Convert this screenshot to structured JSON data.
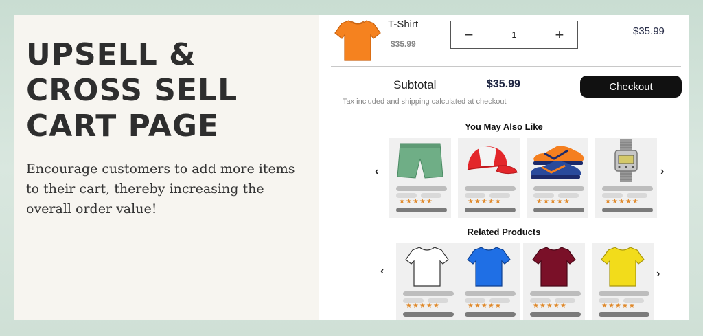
{
  "hero": {
    "title_lines": [
      "UPSELL &",
      "CROSS SELL",
      "CART PAGE"
    ],
    "blurb": "Encourage customers to add more items to their cart, thereby increasing the overall order value!"
  },
  "cart": {
    "item": {
      "name": "T-Shirt",
      "unit_price": "$35.99",
      "quantity": "1",
      "line_price": "$35.99",
      "icon": "orange-tshirt"
    },
    "minus_label": "−",
    "plus_label": "+",
    "subtotal_label": "Subtotal",
    "subtotal_value": "$35.99",
    "checkout_label": "Checkout",
    "tax_note": "Tax included and shipping calculated at checkout"
  },
  "upsell": {
    "title": "You May Also Like",
    "prev_arrow": "‹",
    "next_arrow": "›",
    "items": [
      {
        "icon": "shorts-icon",
        "stars": "★★★★★"
      },
      {
        "icon": "cap-icon",
        "stars": "★★★★★"
      },
      {
        "icon": "sneaker-icon",
        "stars": "★★★★★"
      },
      {
        "icon": "watch-icon",
        "stars": "★★★★★"
      }
    ]
  },
  "related": {
    "title": "Related Products",
    "prev_arrow": "‹",
    "next_arrow": "›",
    "items": [
      {
        "icon": "white-tshirt-icon",
        "color": "#ffffff",
        "stars": "★★★★★"
      },
      {
        "icon": "blue-tshirt-icon",
        "color": "#1f6fe5",
        "stars": "★★★★★"
      },
      {
        "icon": "maroon-tshirt-icon",
        "color": "#7a1028",
        "stars": "★★★★★"
      },
      {
        "icon": "yellow-tshirt-icon",
        "color": "#f2dc1b",
        "stars": "★★★★★"
      }
    ]
  },
  "colors": {
    "tshirt_orange": "#f5821f",
    "checkout_bg": "#111111",
    "star": "#e08a2c",
    "shorts": "#6fae86",
    "cap_red": "#e3262a"
  }
}
